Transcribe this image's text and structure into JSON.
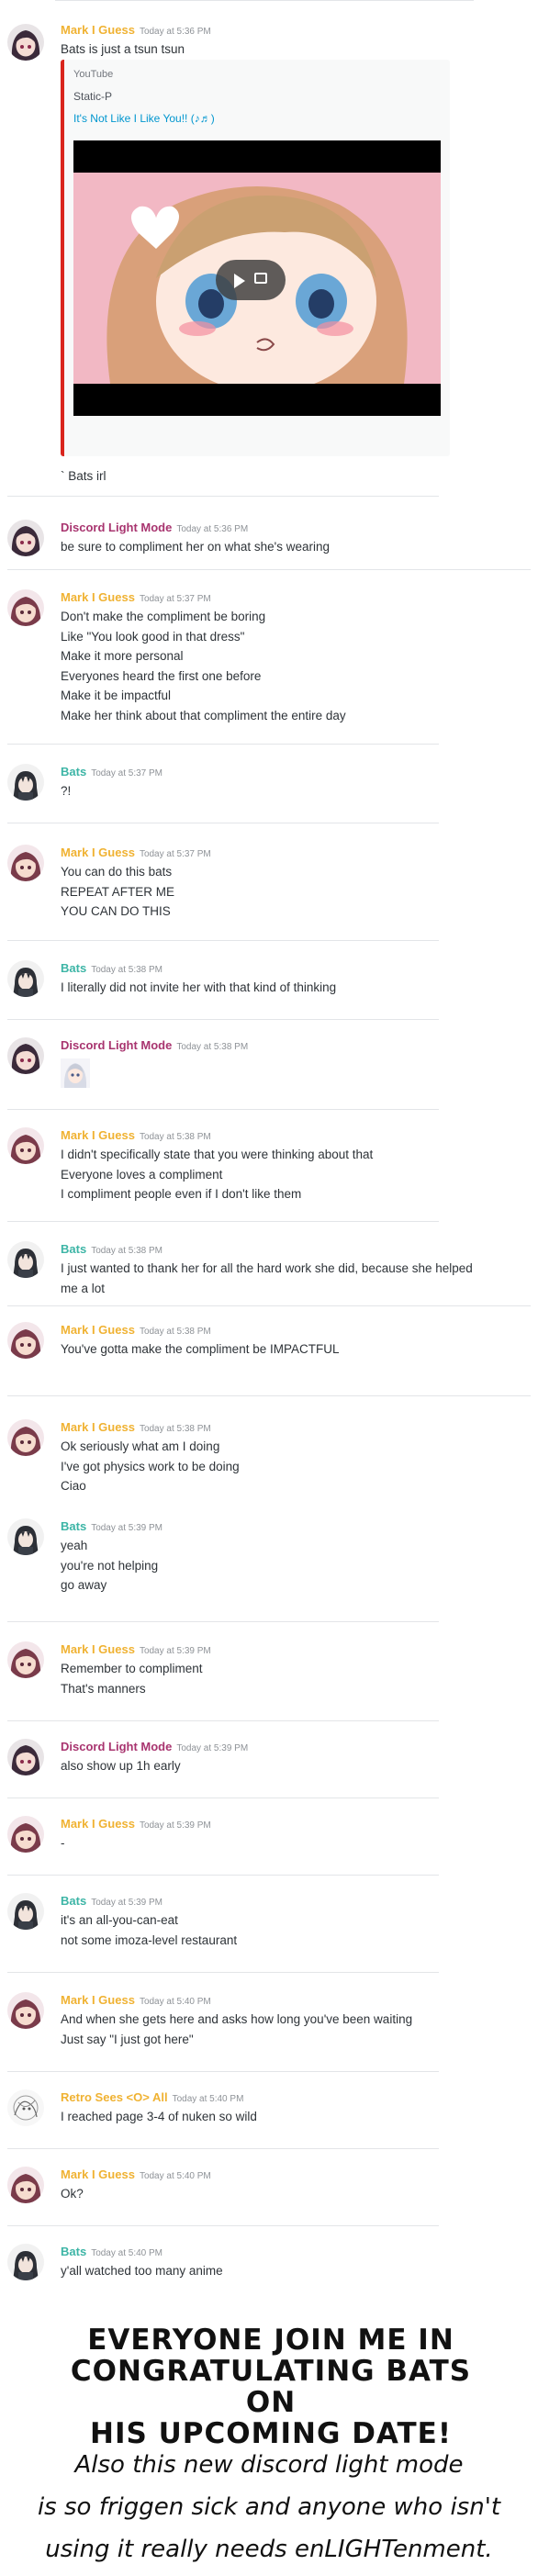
{
  "colors": {
    "mark": "#f0b232",
    "discord": "#a8346f",
    "bats": "#3db5a6",
    "retro": "#f0b232",
    "text": "#2e3338",
    "timestamp": "#8e9297",
    "link": "#0096cf",
    "embed_border": "#d9251d"
  },
  "authors": {
    "mark": "Mark I Guess",
    "discord": "Discord Light Mode",
    "bats": "Bats",
    "retro": "Retro Sees <O> All"
  },
  "messages": [
    {
      "author": "Mark I Guess",
      "time": "Today at 5:36 PM",
      "lines": [
        "Bats is just a tsun tsun"
      ],
      "link": "https://www.youtube.com/watch?v=tOzOD-82mW0"
    },
    {
      "caption": "` Bats irl"
    },
    {
      "author": "Discord Light Mode",
      "time": "Today at 5:36 PM",
      "lines": [
        "be sure to compliment her on what she's wearing"
      ]
    },
    {
      "author": "Mark I Guess",
      "time": "Today at 5:37 PM",
      "lines": [
        "Don't make the compliment be boring",
        "Like \"You look good in that dress\"",
        "Make it more personal",
        "Everyones heard the first one before",
        "Make it be impactful",
        "Make her think about that compliment the entire day"
      ]
    },
    {
      "author": "Bats",
      "time": "Today at 5:37 PM",
      "lines": [
        "?!"
      ]
    },
    {
      "author": "Mark I Guess",
      "time": "Today at 5:37 PM",
      "lines": [
        "You can do this bats",
        "REPEAT AFTER ME",
        "YOU CAN DO THIS"
      ]
    },
    {
      "author": "Bats",
      "time": "Today at 5:38 PM",
      "lines": [
        "I literally did not invite her with that kind of thinking"
      ]
    },
    {
      "author": "Discord Light Mode",
      "time": "Today at 5:38 PM",
      "lines": []
    },
    {
      "author": "Mark I Guess",
      "time": "Today at 5:38 PM",
      "lines": [
        "I didn't specifically state that you were thinking about that",
        "Everyone loves a compliment",
        "I compliment people even if I don't like them"
      ]
    },
    {
      "author": "Bats",
      "time": "Today at 5:38 PM",
      "lines": [
        "I just wanted to thank her for all the hard work she did, because she helped",
        "me a lot"
      ]
    },
    {
      "author": "Mark I Guess",
      "time": "Today at 5:38 PM",
      "lines": [
        "You've gotta make the compliment be IMPACTFUL"
      ]
    },
    {
      "author": "Mark I Guess",
      "time": "Today at 5:38 PM",
      "lines": [
        "Ok seriously what am I doing",
        "I've got physics work to be doing",
        "Ciao"
      ]
    },
    {
      "author": "Bats",
      "time": "Today at 5:39 PM",
      "lines": [
        "yeah",
        "you're not helping",
        "go away"
      ]
    },
    {
      "author": "Mark I Guess",
      "time": "Today at 5:39 PM",
      "lines": [
        "Remember to compliment",
        "That's manners"
      ]
    },
    {
      "author": "Discord Light Mode",
      "time": "Today at 5:39 PM",
      "lines": [
        "also show up 1h early"
      ]
    },
    {
      "author": "Mark I Guess",
      "time": "Today at 5:39 PM",
      "lines": [
        "-"
      ]
    },
    {
      "author": "Bats",
      "time": "Today at 5:39 PM",
      "lines": [
        "it's an all-you-can-eat",
        "not some imoza-level restaurant"
      ]
    },
    {
      "author": "Mark I Guess",
      "time": "Today at 5:40 PM",
      "lines": [
        "And when she gets here and asks how long you've been waiting",
        "Just say \"I just got here\""
      ]
    },
    {
      "author": "Retro Sees <O> All",
      "time": "Today at 5:40 PM",
      "lines": [
        "I reached page 3-4 of nuken so wild"
      ]
    },
    {
      "author": "Mark I Guess",
      "time": "Today at 5:40 PM",
      "lines": [
        "Ok?"
      ]
    },
    {
      "author": "Bats",
      "time": "Today at 5:40 PM",
      "lines": [
        "y'all watched too many anime"
      ]
    }
  ],
  "embed": {
    "provider": "YouTube",
    "author": "Static-P",
    "title": "It's Not Like I Like You!! (♪♬)"
  },
  "caption": {
    "line1": "EVERYONE JOIN ME IN",
    "line2": "CONGRATULATING BATS ON",
    "line3": "HIS UPCOMING DATE!",
    "line4": "Also this new discord light mode",
    "line5": "is so friggen sick and anyone who isn't",
    "line6": "using it really needs enLIGHTenment."
  }
}
